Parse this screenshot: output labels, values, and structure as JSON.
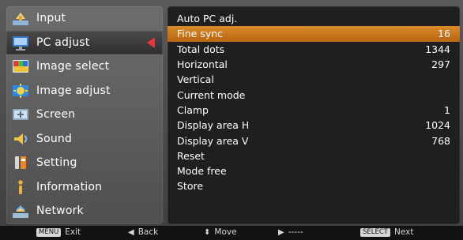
{
  "left_menu": {
    "items": [
      {
        "label": "Input",
        "icon": "input-icon"
      },
      {
        "label": "PC adjust",
        "icon": "pc-adjust-icon",
        "active": true
      },
      {
        "label": "Image select",
        "icon": "image-select-icon"
      },
      {
        "label": "Image adjust",
        "icon": "image-adjust-icon"
      },
      {
        "label": "Screen",
        "icon": "screen-icon"
      },
      {
        "label": "Sound",
        "icon": "sound-icon"
      },
      {
        "label": "Setting",
        "icon": "setting-icon"
      },
      {
        "label": "Information",
        "icon": "information-icon"
      },
      {
        "label": "Network",
        "icon": "network-icon"
      }
    ]
  },
  "right_panel": {
    "rows": [
      {
        "label": "Auto PC adj.",
        "value": ""
      },
      {
        "label": "Fine sync",
        "value": "16",
        "selected": true
      },
      {
        "label": "Total dots",
        "value": "1344"
      },
      {
        "label": "Horizontal",
        "value": "297"
      },
      {
        "label": "Vertical",
        "value": ""
      },
      {
        "label": "Current mode",
        "value": ""
      },
      {
        "label": "Clamp",
        "value": "1"
      },
      {
        "label": "Display area H",
        "value": "1024"
      },
      {
        "label": "Display area V",
        "value": "768"
      },
      {
        "label": "Reset",
        "value": ""
      },
      {
        "label": "Mode free",
        "value": ""
      },
      {
        "label": "Store",
        "value": ""
      }
    ]
  },
  "bottom_bar": {
    "menu_key": "MENU",
    "exit": "Exit",
    "back": "Back",
    "move": "Move",
    "dashes": "-----",
    "select_key": "SELECT",
    "next": "Next"
  },
  "colors": {
    "selection_orange": "#c77419",
    "arrow_red": "#e33333"
  }
}
